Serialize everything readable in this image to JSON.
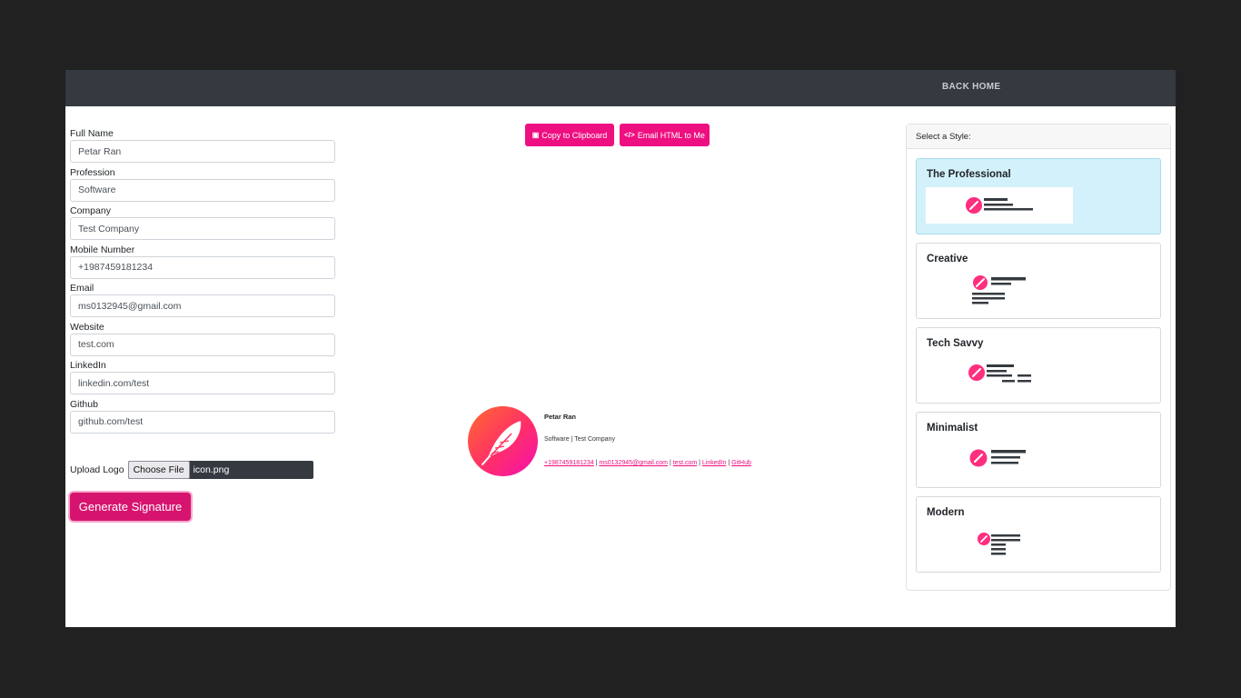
{
  "nav": {
    "back_home": "BACK HOME"
  },
  "form": {
    "fields": [
      {
        "label": "Full Name",
        "value": "Petar Ran"
      },
      {
        "label": "Profession",
        "value": "Software"
      },
      {
        "label": "Company",
        "value": "Test Company"
      },
      {
        "label": "Mobile Number",
        "value": "+1987459181234"
      },
      {
        "label": "Email",
        "value": "ms0132945@gmail.com"
      },
      {
        "label": "Website",
        "value": "test.com"
      },
      {
        "label": "LinkedIn",
        "value": "linkedin.com/test"
      },
      {
        "label": "Github",
        "value": "github.com/test"
      }
    ],
    "upload_label": "Upload Logo",
    "choose_file": "Choose File",
    "file_name": "icon.png",
    "generate": "Generate Signature"
  },
  "actions": {
    "copy": "Copy to Clipboard",
    "email": "Email HTML to Me"
  },
  "signature": {
    "name": "Petar Ran",
    "subtitle": "Software | Test Company",
    "links": [
      "+1987459181234",
      "ms0132945@gmail.com",
      "test.com",
      "LinkedIn",
      "GitHub"
    ],
    "separator": " | "
  },
  "styles": {
    "header": "Select a Style:",
    "items": [
      {
        "name": "The Professional",
        "selected": true
      },
      {
        "name": "Creative",
        "selected": false
      },
      {
        "name": "Tech Savvy",
        "selected": false
      },
      {
        "name": "Minimalist",
        "selected": false
      },
      {
        "name": "Modern",
        "selected": false
      }
    ]
  },
  "colors": {
    "accent": "#ee0f81",
    "navbar": "#343a40",
    "selected_card": "#d2f1fb",
    "generate": "#d6146f"
  }
}
